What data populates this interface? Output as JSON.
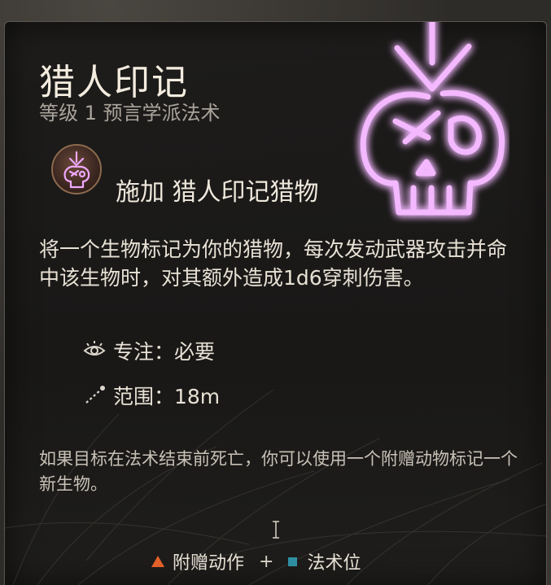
{
  "tooltip": {
    "title": "猎人印记",
    "subtitle": "等级 1 预言学派法术",
    "cast_label": "施加 猎人印记猎物",
    "description": "将一个生物标记为你的猎物，每次发动武器攻击并命中该生物时，对其额外造成1d6穿刺伤害。",
    "properties": [
      {
        "icon": "concentration-icon",
        "text": "专注：必要"
      },
      {
        "icon": "range-icon",
        "text": "范围：18m"
      }
    ],
    "note": "如果目标在法术结束前死亡，你可以使用一个附赠动物标记一个新生物。",
    "cost": {
      "bonus_action_label": "附赠动作",
      "separator": "+",
      "spell_slot_label": "法术位",
      "bonus_action_color": "#e2602a",
      "spell_slot_color": "#2f8fa2"
    }
  },
  "colors": {
    "glow": "#e07aff",
    "text_primary": "#f3ecdf",
    "text_secondary": "#a9a39a"
  }
}
